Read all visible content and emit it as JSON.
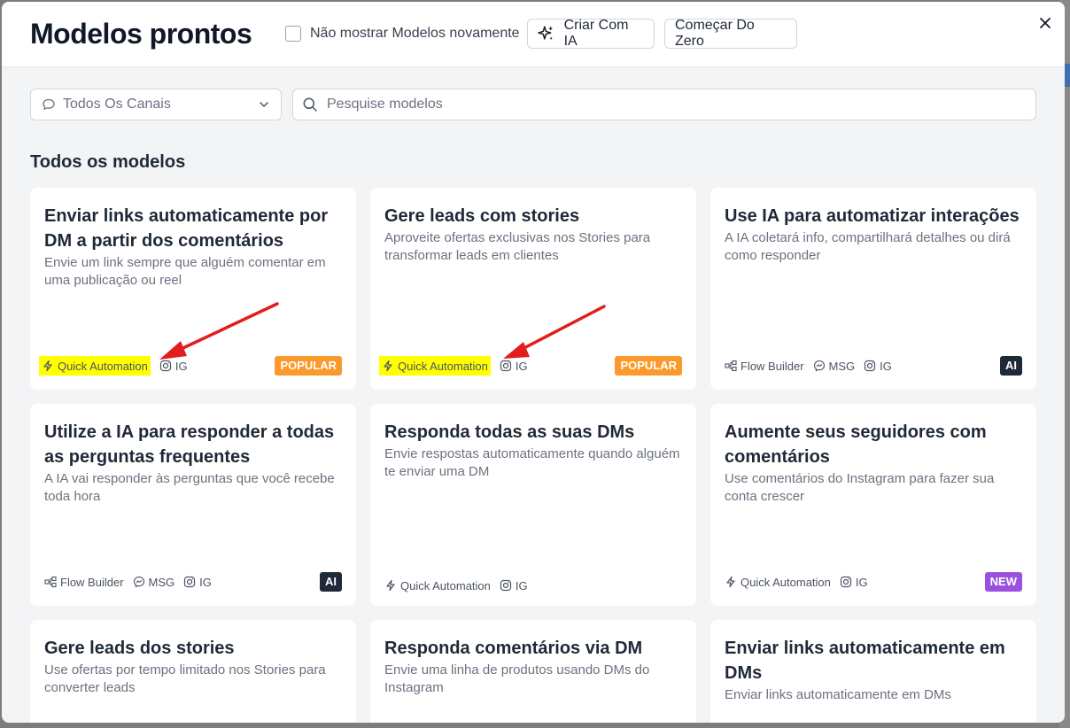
{
  "header": {
    "title": "Modelos prontos",
    "dont_show_label": "Não mostrar Modelos novamente",
    "create_ai_label": "Criar Com IA",
    "start_zero_label": "Começar Do Zero"
  },
  "filters": {
    "channel_value": "Todos Os Canais",
    "search_placeholder": "Pesquise modelos"
  },
  "section_title": "Todos os modelos",
  "tag_labels": {
    "quick": "Quick Automation",
    "flow": "Flow Builder",
    "msg": "MSG",
    "ig": "IG"
  },
  "badges": {
    "popular": "POPULAR",
    "ai": "AI",
    "new": "NEW"
  },
  "cards": [
    {
      "title": "Enviar links automaticamente por DM a partir dos comentários",
      "desc": "Envie um link sempre que alguém comentar em uma publicação ou reel"
    },
    {
      "title": "Gere leads com stories",
      "desc": "Aproveite ofertas exclusivas nos Stories para transformar leads em clientes"
    },
    {
      "title": "Use IA para automatizar interações",
      "desc": "A IA coletará info, compartilhará detalhes ou dirá como responder"
    },
    {
      "title": "Utilize a IA para responder a todas as perguntas frequentes",
      "desc": "A IA vai responder às perguntas que você recebe toda hora"
    },
    {
      "title": "Responda todas as suas DMs",
      "desc": "Envie respostas automaticamente quando alguém te enviar uma DM"
    },
    {
      "title": "Aumente seus seguidores com comentários",
      "desc": "Use comentários do Instagram para fazer sua conta crescer"
    },
    {
      "title": "Gere leads dos stories",
      "desc": "Use ofertas por tempo limitado nos Stories para converter leads"
    },
    {
      "title": "Responda comentários via DM",
      "desc": "Envie uma linha de produtos usando DMs do Instagram"
    },
    {
      "title": "Enviar links automaticamente em DMs",
      "desc": "Enviar links automaticamente em DMs"
    }
  ],
  "colors": {
    "highlight": "#ffff00",
    "popular": "#fb9a2c",
    "ai": "#1f2937",
    "new": "#9b51e0",
    "annotation_arrow": "#e11d1d"
  }
}
